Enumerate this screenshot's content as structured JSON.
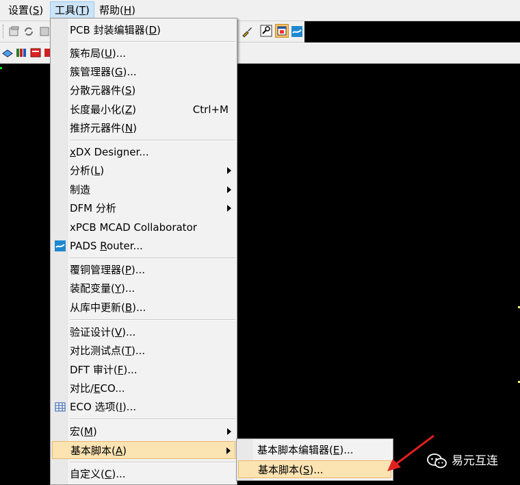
{
  "menubar": {
    "settings": {
      "pre": "设置(",
      "key": "S",
      "post": ")"
    },
    "tools": {
      "pre": "工具(",
      "key": "T",
      "post": ")"
    },
    "help": {
      "pre": "帮助(",
      "key": "H",
      "post": ")"
    }
  },
  "tools_menu": {
    "items": [
      {
        "pre": "PCB 封装编辑器(",
        "key": "D",
        "post": ")"
      },
      {
        "pre": "簇布局(",
        "key": "U",
        "post": ")..."
      },
      {
        "pre": "簇管理器(",
        "key": "G",
        "post": ")..."
      },
      {
        "pre": "分散元器件(",
        "key": "S",
        "post": ")"
      },
      {
        "pre": "长度最小化(",
        "key": "Z",
        "post": ")",
        "shortcut": "Ctrl+M"
      },
      {
        "pre": "推挤元器件(",
        "key": "N",
        "post": ")"
      },
      {
        "pre": "",
        "key": "x",
        "post": "DX Designer..."
      },
      {
        "pre": "分析(",
        "key": "L",
        "post": ")"
      },
      {
        "pre": "制造",
        "key": "",
        "post": ""
      },
      {
        "pre": "DFM 分析",
        "key": "",
        "post": ""
      },
      {
        "pre": "xPCB MCAD Collaborator",
        "key": "",
        "post": ""
      },
      {
        "pre": "PADS ",
        "key": "R",
        "post": "outer..."
      },
      {
        "pre": "覆铜管理器(",
        "key": "P",
        "post": ")..."
      },
      {
        "pre": "装配变量(",
        "key": "Y",
        "post": ")..."
      },
      {
        "pre": "从库中更新(",
        "key": "B",
        "post": ")..."
      },
      {
        "pre": "验证设计(",
        "key": "V",
        "post": ")..."
      },
      {
        "pre": "对比测试点(",
        "key": "T",
        "post": ")..."
      },
      {
        "pre": "DFT 审计(",
        "key": "F",
        "post": ")..."
      },
      {
        "pre": "对比/",
        "key": "E",
        "post": "CO..."
      },
      {
        "pre": "ECO 选项(",
        "key": "I",
        "post": ")..."
      },
      {
        "pre": "宏(",
        "key": "M",
        "post": ")"
      },
      {
        "pre": "基本脚本(",
        "key": "A",
        "post": ")"
      },
      {
        "pre": "自定义(",
        "key": "C",
        "post": ")..."
      }
    ]
  },
  "basic_script_submenu": {
    "items": [
      {
        "pre": "基本脚本编辑器(",
        "key": "E",
        "post": ")..."
      },
      {
        "pre": "基本脚本(",
        "key": "S",
        "post": ")..."
      }
    ]
  },
  "watermark": {
    "text": "易元互连"
  },
  "colors": {
    "highlight": "#fbe3b2",
    "canvas": "#000000",
    "menu_bg": "#f2f2f2",
    "arrow": "#e02020"
  }
}
